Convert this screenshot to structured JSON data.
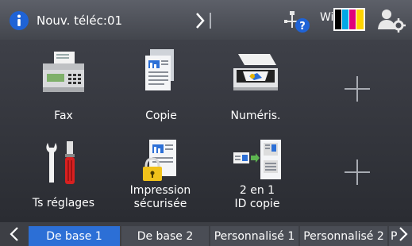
{
  "status_bar": {
    "info_text": "Nouv. téléc:01",
    "wifi_label": "WiFi",
    "ink_colors": [
      "#000000",
      "#00a7e6",
      "#e0007a",
      "#ffd400"
    ]
  },
  "tiles": [
    {
      "label": "Fax",
      "icon": "fax-icon"
    },
    {
      "label": "Copie",
      "icon": "copy-icon"
    },
    {
      "label": "Numéris.",
      "icon": "scanner-icon"
    },
    {
      "label": "Ts réglages",
      "icon": "settings-tools-icon"
    },
    {
      "label_line1": "Impression",
      "label_line2": "sécurisée",
      "icon": "secure-print-icon"
    },
    {
      "label_line1": "2 en 1",
      "label_line2": "ID copie",
      "icon": "id-copy-icon"
    }
  ],
  "tabs": [
    {
      "label": "De base 1",
      "active": true
    },
    {
      "label": "De base 2",
      "active": false
    },
    {
      "label": "Personnalisé 1",
      "active": false
    },
    {
      "label": "Personnalisé 2",
      "active": false
    },
    {
      "label": "P",
      "active": false
    }
  ],
  "accent_color": "#2c6fd6"
}
